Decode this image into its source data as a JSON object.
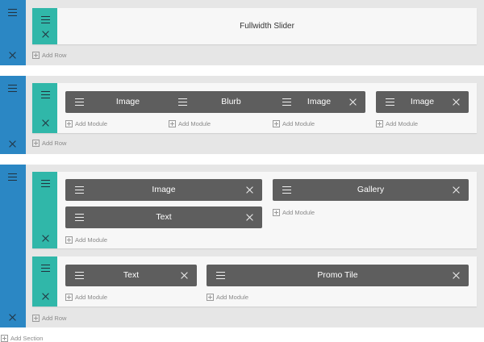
{
  "sections": [
    {
      "rows": [
        {
          "modules": [
            {
              "label": "Fullwidth Slider"
            }
          ]
        }
      ],
      "add_row_label": "Add Row"
    },
    {
      "rows": [
        {
          "modules": [
            {
              "label": "Image"
            },
            {
              "label": "Blurb"
            },
            {
              "label": "Image"
            },
            {
              "label": "Image"
            }
          ],
          "add_module_labels": [
            "Add Module",
            "Add Module",
            "Add Module",
            "Add Module"
          ]
        }
      ],
      "add_row_label": "Add Row"
    },
    {
      "rows": [
        {
          "modules": [
            {
              "label": "Image"
            },
            {
              "label": "Text"
            },
            {
              "label": "Gallery"
            }
          ],
          "add_module_labels": [
            "Add Module",
            "Add Module"
          ]
        },
        {
          "modules": [
            {
              "label": "Text"
            },
            {
              "label": "Promo Tile"
            }
          ],
          "add_module_labels": [
            "Add Module",
            "Add Module"
          ]
        }
      ],
      "add_row_label": "Add Row"
    }
  ],
  "add_section_label": "Add Section",
  "icons": {
    "drag": "hamburger-icon",
    "delete": "close-icon",
    "add": "plus-square-icon"
  },
  "colors": {
    "section_bar": "#2b87c4",
    "row_bar": "#30b7a9",
    "module": "#5e5e5e",
    "background": "#e6e6e6"
  }
}
